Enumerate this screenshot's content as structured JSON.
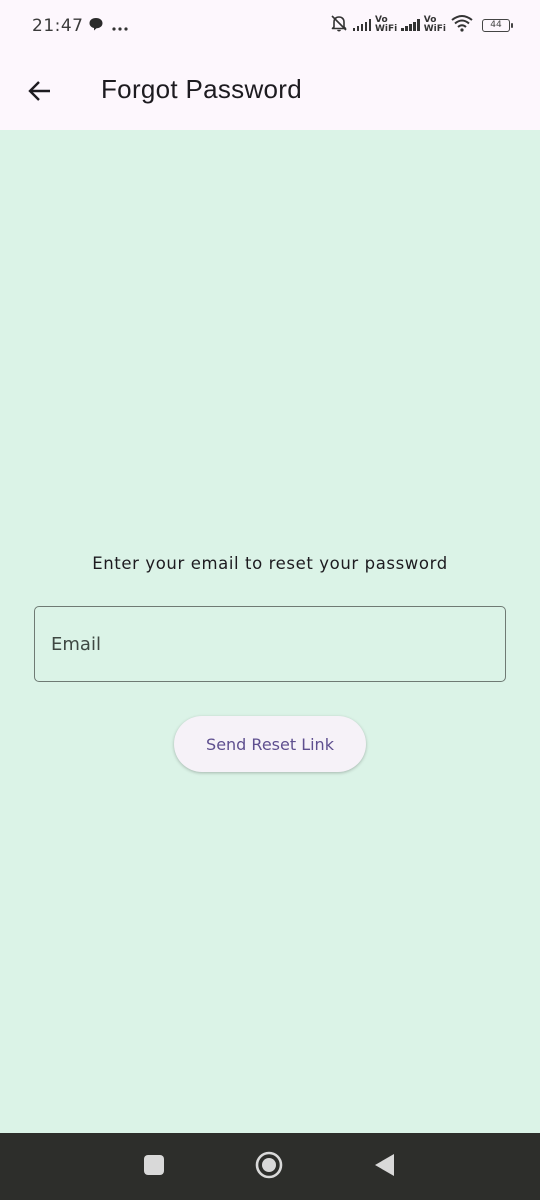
{
  "status_bar": {
    "time": "21:47",
    "vowifi_top": "Vo",
    "vowifi_bottom": "WiFi",
    "battery_level": "44"
  },
  "app_bar": {
    "title": "Forgot Password"
  },
  "main": {
    "instruction": "Enter your email to reset your password",
    "email_placeholder": "Email",
    "email_value": "",
    "send_button_label": "Send Reset Link"
  },
  "colors": {
    "background": "#dbf3e7",
    "app_bar": "#fdf7fd",
    "button_text": "#5e4f8f",
    "nav_bar": "#2d2e2b"
  }
}
